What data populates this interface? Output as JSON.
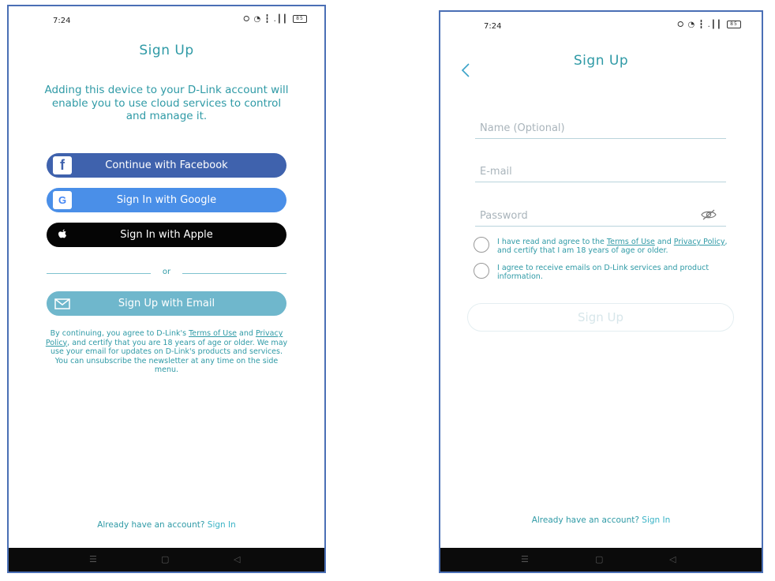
{
  "screen1": {
    "status": {
      "time": "7:24",
      "icons": "⭘ ◔ ┇ .┃┃",
      "battery": "85"
    },
    "title": "Sign Up",
    "intro": "Adding this device to your D-Link account will enable you to use cloud services to control and manage it.",
    "facebook_label": "Continue with Facebook",
    "google_label": "Sign In with Google",
    "apple_label": "Sign In with Apple",
    "or_label": "or",
    "email_label": "Sign Up with Email",
    "legal": {
      "part1": "By continuing, you agree to D-Link's",
      "terms": "Terms of Use",
      "and": "and",
      "privacy": "Privacy Policy",
      "part2": ", and certify that you are 18 years of age or older. We may use your email for updates on D-Link's products and services. You can unsubscribe the newsletter at any time on the side menu."
    },
    "already_text": "Already have an account?",
    "sign_in": "Sign In"
  },
  "screen2": {
    "status": {
      "time": "7:24",
      "icons": "⭘ ◔ ┇ .┃┃",
      "battery": "85"
    },
    "title": "Sign Up",
    "name_placeholder": "Name (Optional)",
    "email_placeholder": "E-mail",
    "password_placeholder": "Password",
    "agree1": {
      "part1": "I have read and agree to the",
      "terms": "Terms of Use",
      "and": "and",
      "privacy": "Privacy Policy",
      "part2": ", and certify that I am 18 years of age or older."
    },
    "agree2": "I agree to receive emails on D-Link services and product information.",
    "submit_label": "Sign Up",
    "already_text": "Already have an account?",
    "sign_in": "Sign In"
  },
  "colors": {
    "accent": "#2f9aa6",
    "facebook": "#3f62ad",
    "google": "#4a8fe8",
    "apple": "#050505",
    "email": "#6fb7cc"
  }
}
